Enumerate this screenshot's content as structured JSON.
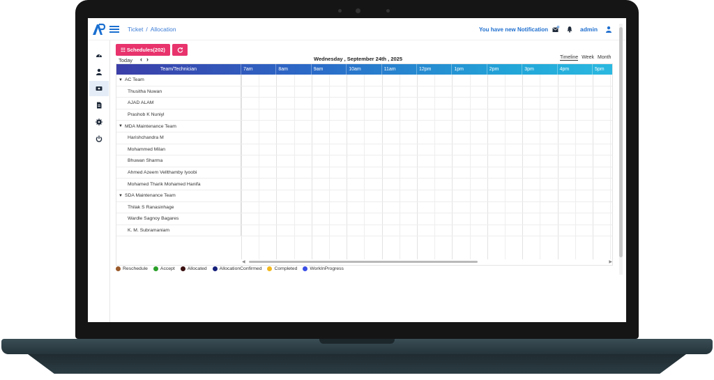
{
  "header": {
    "breadcrumb": [
      "Ticket",
      "Allocation"
    ],
    "notification_text": "You have new Notification",
    "user": "admin"
  },
  "sidebar": {
    "items": [
      {
        "icon": "dashboard-icon"
      },
      {
        "icon": "user-icon"
      },
      {
        "icon": "ticket-icon",
        "active": true
      },
      {
        "icon": "document-icon"
      },
      {
        "icon": "gear-icon"
      },
      {
        "icon": "power-icon"
      }
    ]
  },
  "toolbar": {
    "schedules_label": "☷ Schedules(202)",
    "today_label": "Today",
    "prev": "‹",
    "next": "›",
    "date": "Wednesday , September 24th , 2025",
    "views": [
      "Timeline",
      "Week",
      "Month"
    ],
    "selected_view": "Timeline"
  },
  "grid": {
    "team_column": "Team/Technician",
    "hours": [
      "7am",
      "8am",
      "9am",
      "10am",
      "11am",
      "12pm",
      "1pm",
      "2pm",
      "3pm",
      "4pm",
      "5pm"
    ],
    "rows": [
      {
        "type": "team",
        "label": "AC Team"
      },
      {
        "type": "member",
        "label": "Thusitha Nuwan"
      },
      {
        "type": "member",
        "label": "AJAD ALAM"
      },
      {
        "type": "member",
        "label": "Prashob K Nuniyl"
      },
      {
        "type": "team",
        "label": "MDA Maintenance Team"
      },
      {
        "type": "member",
        "label": "Harishchandra M"
      },
      {
        "type": "member",
        "label": "Mohammed Milan"
      },
      {
        "type": "member",
        "label": "Bhuwan Sharma"
      },
      {
        "type": "member",
        "label": "Ahmed Azeem Vellthamby Iyoobi"
      },
      {
        "type": "member",
        "label": "Mohamed Tharik Mohamed Hanifa"
      },
      {
        "type": "team",
        "label": "SDA Maintenance Team"
      },
      {
        "type": "member",
        "label": "Thilak S Ranasinhage"
      },
      {
        "type": "member",
        "label": "Wardle Sagnoy Bagares"
      },
      {
        "type": "member",
        "label": "K. M. Subramaniam"
      }
    ]
  },
  "legend": [
    {
      "label": "Reschedule",
      "color": "#9a5a2a"
    },
    {
      "label": "Accept",
      "color": "#2aa02a"
    },
    {
      "label": "Allocated",
      "color": "#3a1010"
    },
    {
      "label": "AllocationConfirmed",
      "color": "#15207a"
    },
    {
      "label": "Completed",
      "color": "#f2b81c"
    },
    {
      "label": "WorkInProgress",
      "color": "#3a4ee6"
    }
  ],
  "colors": {
    "accent": "#e8336d",
    "link": "#1f6fcf"
  }
}
